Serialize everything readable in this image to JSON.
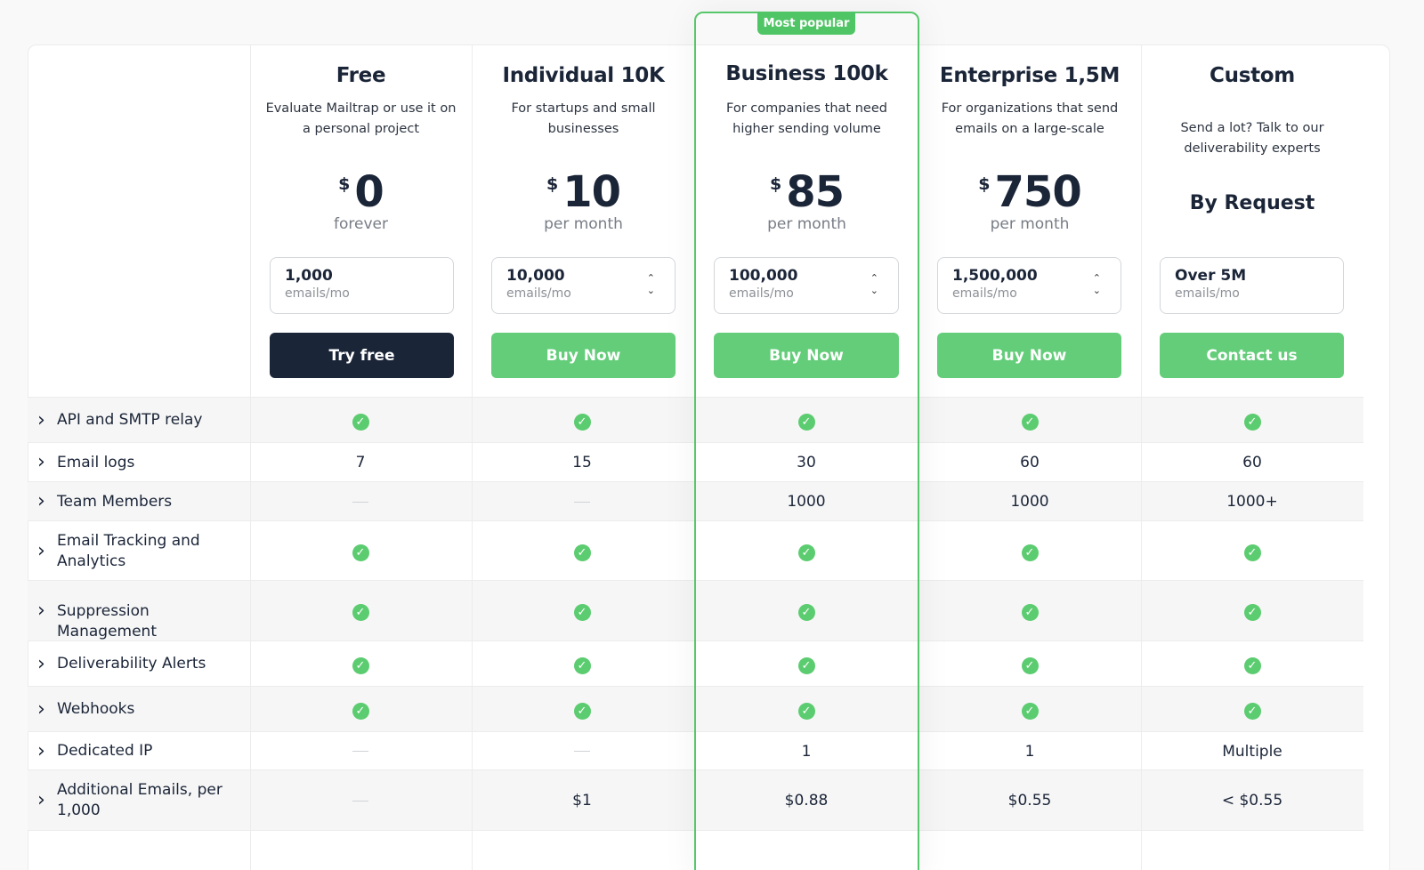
{
  "badge": "Most popular",
  "plans": [
    {
      "name": "Free",
      "desc": "Evaluate Mailtrap or use it on a personal project",
      "currency": "$",
      "amount": "0",
      "period": "forever",
      "volume": "1,000",
      "volume_unit": "emails/mo",
      "button": "Try free"
    },
    {
      "name": "Individual 10K",
      "desc": "For startups and small businesses",
      "currency": "$",
      "amount": "10",
      "period": "per month",
      "volume": "10,000",
      "volume_unit": "emails/mo",
      "button": "Buy Now"
    },
    {
      "name": "Business 100k",
      "desc": "For companies that need higher sending volume",
      "currency": "$",
      "amount": "85",
      "period": "per month",
      "volume": "100,000",
      "volume_unit": "emails/mo",
      "button": "Buy Now"
    },
    {
      "name": "Enterprise 1,5M",
      "desc": "For organizations that send emails on a large-scale",
      "currency": "$",
      "amount": "750",
      "period": "per month",
      "volume": "1,500,000",
      "volume_unit": "emails/mo",
      "button": "Buy Now"
    },
    {
      "name": "Custom",
      "desc": "Send a lot? Talk to our deliverability experts",
      "price_text": "By Request",
      "volume": "Over 5M",
      "volume_unit": "emails/mo",
      "button": "Contact us"
    }
  ],
  "features": [
    {
      "label": "API and SMTP relay",
      "values": [
        "check",
        "check",
        "check",
        "check",
        "check"
      ]
    },
    {
      "label": "Email logs",
      "values": [
        "7",
        "15",
        "30",
        "60",
        "60"
      ]
    },
    {
      "label": "Team Members",
      "values": [
        "dash",
        "dash",
        "1000",
        "1000",
        "1000+"
      ]
    },
    {
      "label": "Email Tracking and Analytics",
      "values": [
        "check",
        "check",
        "check",
        "check",
        "check"
      ]
    },
    {
      "label": "Suppression Management",
      "values": [
        "check",
        "check",
        "check",
        "check",
        "check"
      ]
    },
    {
      "label": "Deliverability Alerts",
      "values": [
        "check",
        "check",
        "check",
        "check",
        "check"
      ]
    },
    {
      "label": "Webhooks",
      "values": [
        "check",
        "check",
        "check",
        "check",
        "check"
      ]
    },
    {
      "label": "Dedicated IP",
      "values": [
        "dash",
        "dash",
        "1",
        "1",
        "Multiple"
      ]
    },
    {
      "label": "Additional Emails, per 1,000",
      "values": [
        "dash",
        "$1",
        "$0.88",
        "$0.55",
        "< $0.55"
      ]
    }
  ],
  "icons": {
    "expand": "chevron-right-icon",
    "check": "check-circle-icon",
    "stepper": "up-down-chevron-icon"
  },
  "colors": {
    "accent": "#63cd79",
    "dark": "#1b2538",
    "popular_border": "#58c76b"
  }
}
